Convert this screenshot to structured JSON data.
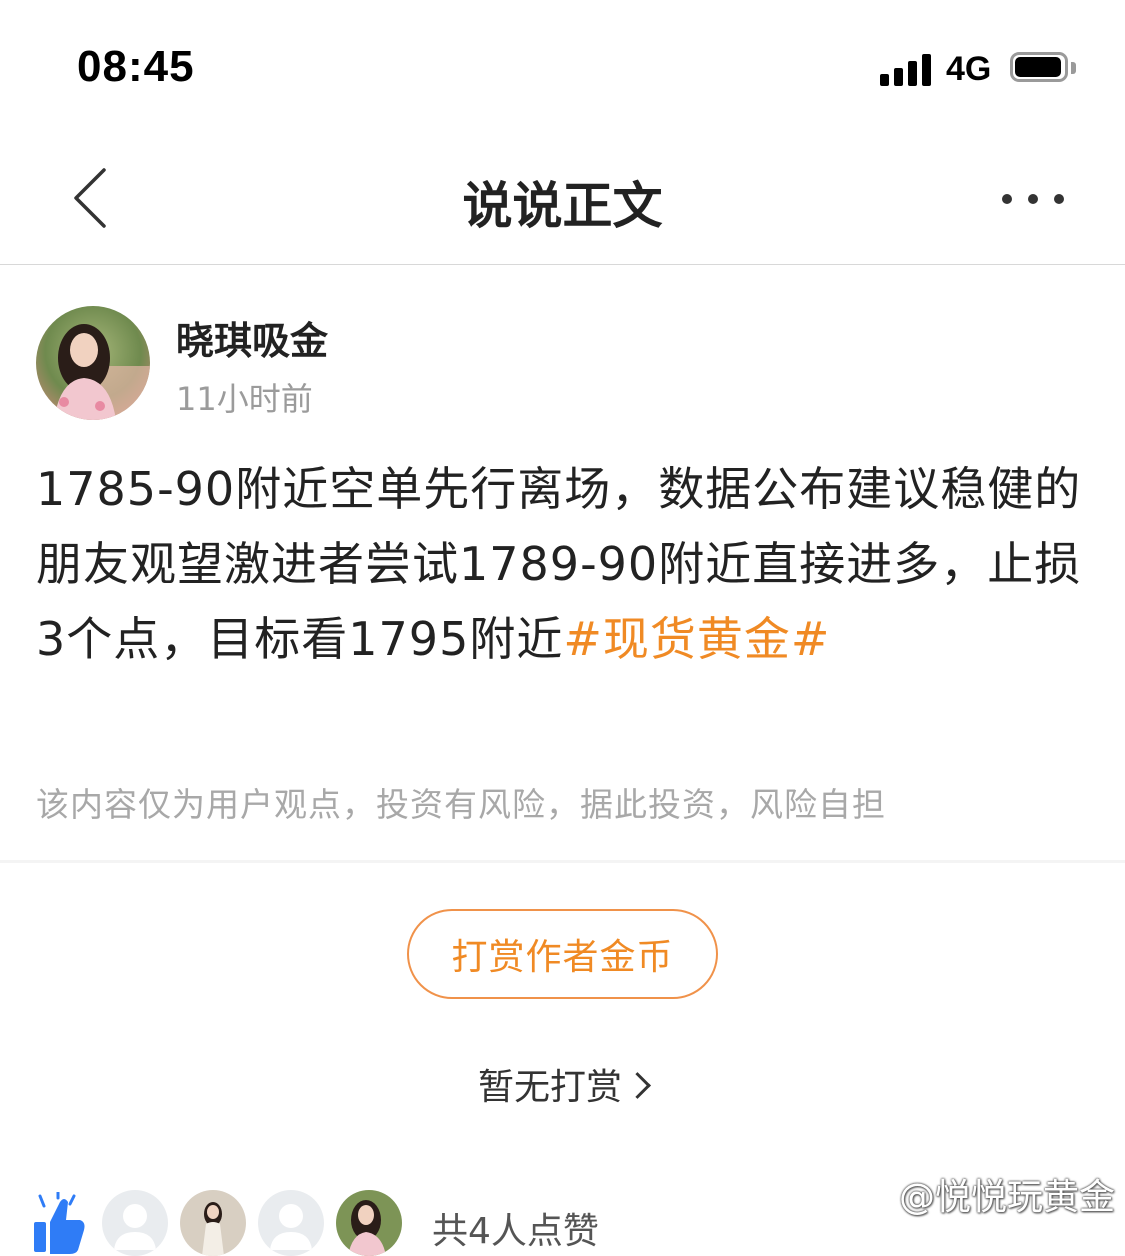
{
  "status_bar": {
    "time": "08:45",
    "network": "4G"
  },
  "nav": {
    "title": "说说正文"
  },
  "author": {
    "name": "晓琪吸金",
    "time": "11小时前"
  },
  "post": {
    "text": "1785-90附近空单先行离场，数据公布建议稳健的朋友观望激进者尝试1789-90附近直接进多，止损3个点，目标看1795附近",
    "tag": "#现货黄金#",
    "disclaimer": "该内容仅为用户观点，投资有风险，据此投资，风险自担"
  },
  "tip": {
    "button_label": "打赏作者金币",
    "no_tips_label": "暂无打赏"
  },
  "likes": {
    "count_label": "共4人点赞"
  },
  "watermark": "@悦悦玩黄金",
  "colors": {
    "accent": "#f08a24",
    "like_icon": "#2f7cf6",
    "muted": "#a8a8a8"
  }
}
